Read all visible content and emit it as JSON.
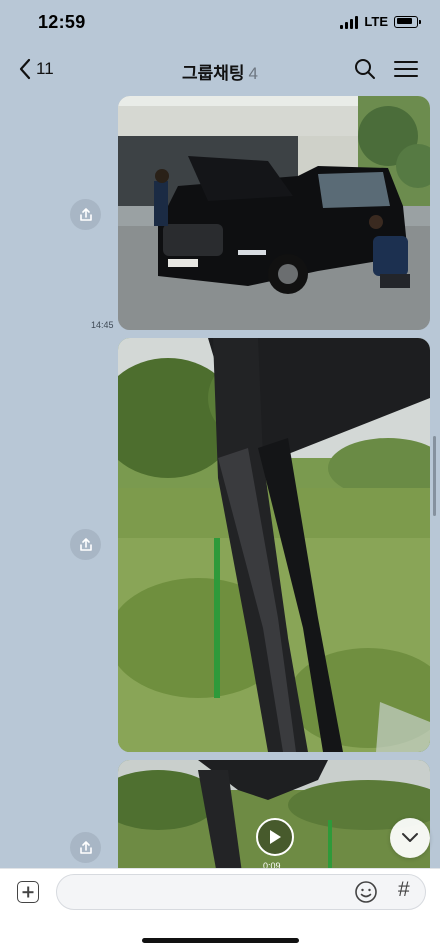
{
  "status_bar": {
    "time": "12:59",
    "network": "LTE",
    "signal_icon": "signal-icon",
    "battery_icon": "battery-icon"
  },
  "header": {
    "back_icon": "chevron-left-icon",
    "back_count": "11",
    "title": "그룹채팅",
    "member_count": "4",
    "search_icon": "search-icon",
    "menu_icon": "hamburger-menu-icon"
  },
  "messages": [
    {
      "type": "photo",
      "description_icon": "photo-image",
      "time": "14:45",
      "share_icon": "share-icon"
    },
    {
      "type": "photo",
      "description_icon": "photo-image",
      "time": "",
      "share_icon": "share-icon"
    },
    {
      "type": "video",
      "description_icon": "video-thumbnail",
      "duration": "0:09",
      "play_icon": "play-icon",
      "share_icon": "share-icon"
    }
  ],
  "scroll_down_icon": "chevron-down-icon",
  "input_bar": {
    "plus_icon": "plus-icon",
    "message_value": "",
    "placeholder": "",
    "emoji_icon": "emoji-icon",
    "hash_symbol": "#"
  },
  "colors": {
    "background": "#b8c7d6",
    "input_bar": "#ffffff"
  }
}
